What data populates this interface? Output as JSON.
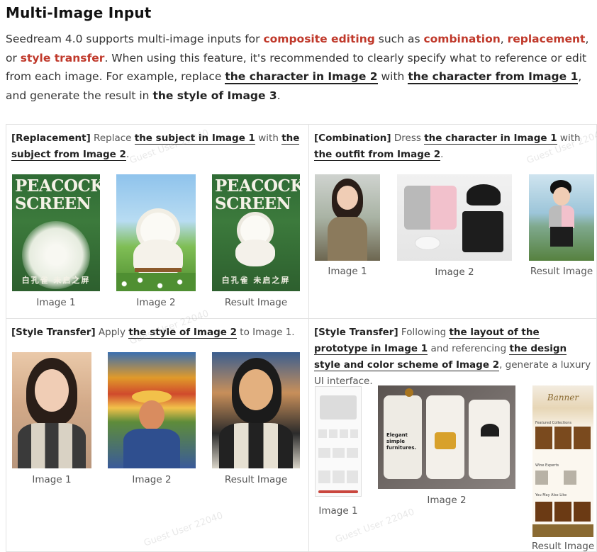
{
  "page": {
    "title": "Multi-Image Input",
    "intro": {
      "p1": "Seedream 4.0 supports multi-image inputs for ",
      "h1": "composite editing",
      "p2": " such as ",
      "h2": "combination",
      "p3": ", ",
      "h3": "replacement",
      "p4": ", or ",
      "h4": "style transfer",
      "p5": ". When using this feature, it's recommended to clearly specify what to reference or edit from each image. For example, replace ",
      "u1": "the character in Image 2",
      "p6": " with ",
      "u2": "the character from Image 1",
      "p7": ", and generate the result in ",
      "b1": "the style of Image 3",
      "p8": "."
    }
  },
  "cells": {
    "replacement": {
      "tag": "[Replacement]",
      "t1": " Replace ",
      "u1": "the subject in Image 1",
      "t2": " with ",
      "u2": "the subject from Image 2",
      "t3": ".",
      "poster_title": "PEACOCK SCREEN",
      "poster_footer": "白孔雀 未启之屏",
      "captions": [
        "Image 1",
        "Image 2",
        "Result Image"
      ]
    },
    "combination": {
      "tag": "[Combination]",
      "t1": " Dress ",
      "u1": "the character in Image 1",
      "t2": " with ",
      "u2": "the outfit from Image 2",
      "t3": ".",
      "captions": [
        "Image 1",
        "Image 2",
        "Result Image"
      ]
    },
    "style1": {
      "tag": "[Style Transfer]",
      "t1": " Apply ",
      "u1": "the style of Image 2",
      "t2": " to Image 1.",
      "captions": [
        "Image 1",
        "Image 2",
        "Result Image"
      ]
    },
    "style2": {
      "tag": "[Style Transfer]",
      "t1": " Following ",
      "u1": "the layout of the prototype in Image 1",
      "t2": " and referencing ",
      "u2": "the design style and color scheme of Image 2",
      "t3": ", generate a luxury UI interface.",
      "captions": [
        "Image 1",
        "Image 2",
        "Result Image"
      ],
      "ui_text": {
        "simple_title": "Elegant simple furnitures.",
        "banner": "Banner",
        "featured": "Featured Collections",
        "wine_experts": "Wine Experts",
        "you_may": "You May Also Like"
      }
    }
  },
  "watermark": "Guest User 22040",
  "colors": {
    "highlight": "#c0392b",
    "text": "#333333",
    "border": "#e2e2e2"
  }
}
